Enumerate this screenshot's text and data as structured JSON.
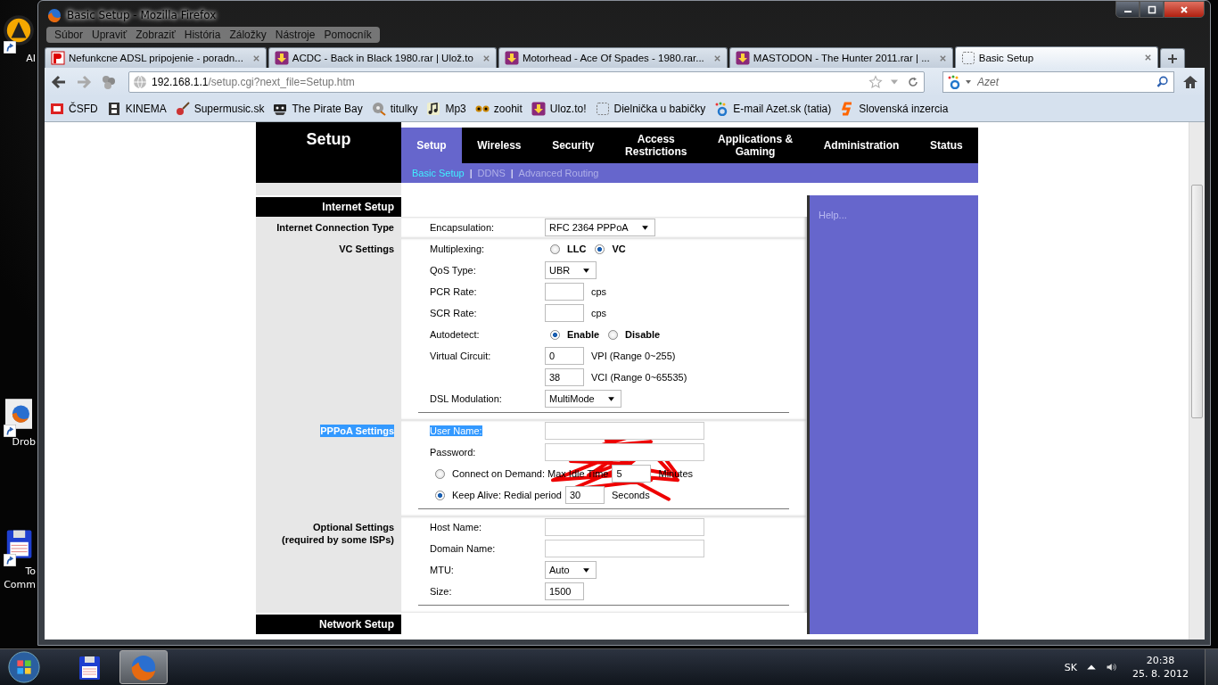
{
  "desktop": {
    "icons": [
      {
        "kind": "aim",
        "lines": [
          "AI"
        ]
      },
      {
        "kind": "firefox",
        "lines": [
          "Drob"
        ]
      },
      {
        "kind": "floppy",
        "lines": [
          "To",
          "Comm"
        ]
      }
    ]
  },
  "window": {
    "title": "Basic Setup - Mozilla Firefox"
  },
  "menu": [
    "Súbor",
    "Upraviť",
    "Zobraziť",
    "História",
    "Záložky",
    "Nástroje",
    "Pomocník"
  ],
  "tabs": [
    {
      "kind": "net",
      "label": "Nefunkcne ADSL pripojenie - poradn...",
      "selected": false
    },
    {
      "kind": "ulozto",
      "label": "ACDC - Back in Black 1980.rar | Ulož.to",
      "selected": false
    },
    {
      "kind": "ulozto",
      "label": "Motorhead - Ace Of Spades - 1980.rar...",
      "selected": false
    },
    {
      "kind": "ulozto",
      "label": "MASTODON - The Hunter 2011.rar | ...",
      "selected": false
    },
    {
      "kind": "blank",
      "label": "Basic Setup",
      "selected": true
    }
  ],
  "address": {
    "host": "192.168.1.1",
    "path": "/setup.cgi?next_file=Setup.htm"
  },
  "search": {
    "placeholder": "Azet"
  },
  "bookmarks": [
    {
      "kind": "csfd",
      "label": "ČSFD"
    },
    {
      "kind": "film",
      "label": "KINEMA"
    },
    {
      "kind": "guitar",
      "label": "Supermusic.sk"
    },
    {
      "kind": "pirate",
      "label": "The Pirate Bay"
    },
    {
      "kind": "reel",
      "label": "titulky"
    },
    {
      "kind": "music",
      "label": "Mp3"
    },
    {
      "kind": "eyes",
      "label": "zoohit"
    },
    {
      "kind": "ulozto",
      "label": "Uloz.to!"
    },
    {
      "kind": "blank",
      "label": "Dielnička u babičky"
    },
    {
      "kind": "azet",
      "label": "E-mail Azet.sk (tatia)"
    },
    {
      "kind": "inzercia",
      "label": "Slovenská inzercia"
    }
  ],
  "page": {
    "title": "Setup",
    "nav": [
      {
        "lines": [
          "Setup"
        ],
        "selected": true
      },
      {
        "lines": [
          "Wireless"
        ],
        "selected": false
      },
      {
        "lines": [
          "Security"
        ],
        "selected": false
      },
      {
        "lines": [
          "Access",
          "Restrictions"
        ],
        "selected": false
      },
      {
        "lines": [
          "Applications &",
          "Gaming"
        ],
        "selected": false
      },
      {
        "lines": [
          "Administration"
        ],
        "selected": false
      },
      {
        "lines": [
          "Status"
        ],
        "selected": false
      }
    ],
    "subnav": [
      {
        "label": "Basic Setup",
        "selected": true,
        "separator": "|"
      },
      {
        "label": "DDNS",
        "selected": false,
        "separator": "|"
      },
      {
        "label": "Advanced Routing",
        "selected": false
      }
    ],
    "help": "Help...",
    "sections": [
      {
        "kind": "header",
        "label": "Internet Setup"
      },
      {
        "kind": "group",
        "label": "Internet Connection Type",
        "divider": false,
        "rows": [
          {
            "kind": "select",
            "label": "Encapsulation:",
            "value": "RFC 2364 PPPoA"
          }
        ]
      },
      {
        "kind": "group",
        "label": "VC Settings",
        "divider": true,
        "rows": [
          {
            "kind": "radio",
            "label": "Multiplexing:",
            "options": [
              {
                "label": "LLC",
                "selected": false
              },
              {
                "label": "VC",
                "selected": true
              }
            ]
          },
          {
            "kind": "select",
            "label": "QoS Type:",
            "value": "UBR"
          },
          {
            "kind": "input",
            "label": "PCR Rate:",
            "unit": "cps"
          },
          {
            "kind": "input",
            "label": "SCR Rate:",
            "unit": "cps"
          },
          {
            "kind": "radio",
            "label": "Autodetect:",
            "options": [
              {
                "label": "Enable",
                "selected": true
              },
              {
                "label": "Disable",
                "selected": false
              }
            ]
          },
          {
            "kind": "input",
            "label": "Virtual Circuit:",
            "value": "0",
            "unit": "VPI (Range 0~255)"
          },
          {
            "kind": "input",
            "value": "38",
            "unit": "VCI (Range 0~65535)"
          },
          {
            "kind": "select",
            "label": "DSL Modulation:",
            "value": "MultiMode"
          }
        ]
      },
      {
        "kind": "group",
        "label": "PPPoA Settings",
        "highlighted": true,
        "divider": true,
        "rows": [
          {
            "kind": "wide-input",
            "label": "User Name:",
            "highlighted": true
          },
          {
            "kind": "wide-input",
            "label": "Password:",
            "highlighted": false
          },
          {
            "kind": "radio-input",
            "label": "Connect on Demand: Max Idle Time",
            "selected": false,
            "value": "5",
            "unit": "Minutes"
          },
          {
            "kind": "radio-input",
            "label": "Keep Alive: Redial period",
            "selected": true,
            "value": "30",
            "unit": "Seconds"
          }
        ]
      },
      {
        "kind": "group",
        "label": "Optional Settings",
        "sublabel": "(required by some ISPs)",
        "divider": true,
        "rows": [
          {
            "kind": "wide-input",
            "label": "Host Name:",
            "highlighted": false
          },
          {
            "kind": "wide-input",
            "label": "Domain Name:",
            "highlighted": false
          },
          {
            "kind": "select",
            "label": "MTU:",
            "value": "Auto"
          },
          {
            "kind": "input",
            "label": "Size:",
            "value": "1500"
          }
        ]
      },
      {
        "kind": "header",
        "label": "Network Setup"
      }
    ]
  },
  "tray": {
    "language": "SK",
    "time": "20:38",
    "date": "25. 8. 2012"
  },
  "taskbar": [
    {
      "kind": "floppy",
      "selected": false
    },
    {
      "kind": "firefox",
      "selected": true
    }
  ]
}
